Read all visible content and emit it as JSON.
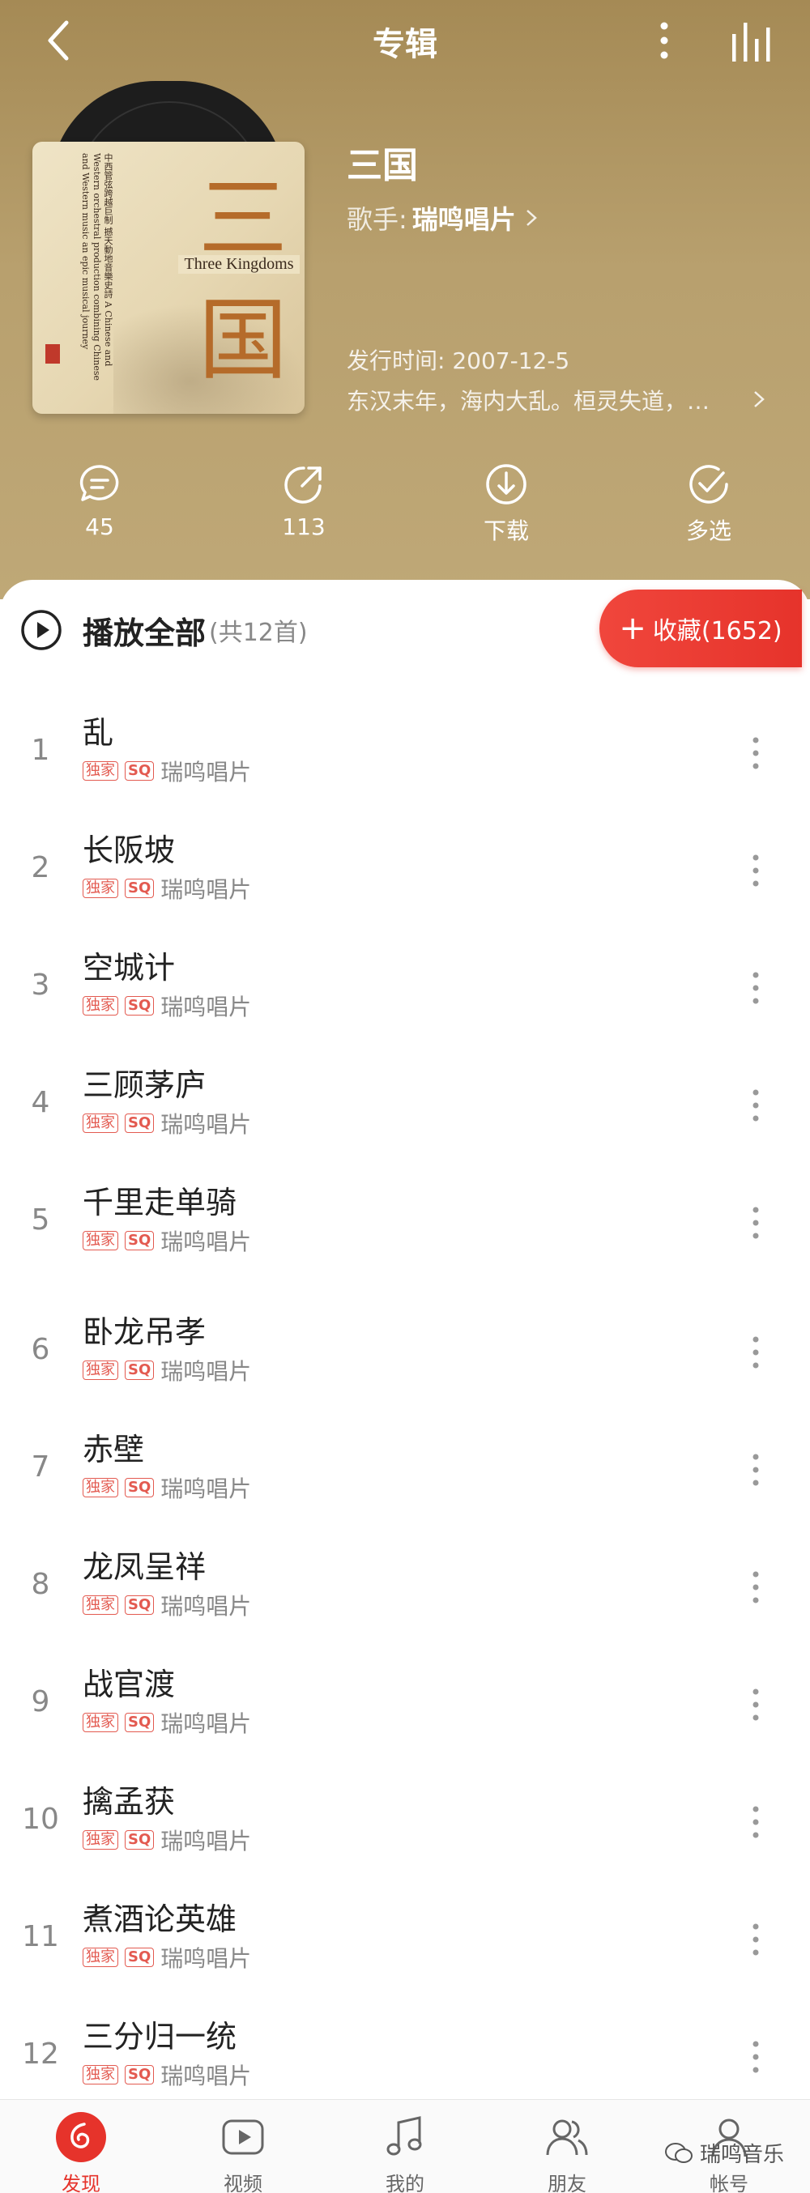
{
  "header": {
    "title": "专辑"
  },
  "album": {
    "name": "三国",
    "artist_prefix": "歌手:",
    "artist": "瑞鸣唱片",
    "release_date": "发行时间: 2007-12-5",
    "description": "东汉末年，海内大乱。桓灵失道，…",
    "cover": {
      "big_char": "三国",
      "english": "Three Kingdoms",
      "vertical_text": "中西管弦跨越巨制 撼天動地音樂史詩 A Chinese and Western orchestral production combining Chinese and Western music an epic musical journey"
    }
  },
  "actions": {
    "comments": "45",
    "share": "113",
    "download": "下载",
    "multiselect": "多选"
  },
  "playlist": {
    "play_all": "播放全部",
    "count": "(共12首)",
    "collect_label": "收藏(1652)"
  },
  "badges": {
    "exclusive": "独家",
    "sq": "SQ"
  },
  "tracks": [
    {
      "num": "1",
      "title": "乱",
      "artist": "瑞鸣唱片"
    },
    {
      "num": "2",
      "title": "长阪坡",
      "artist": "瑞鸣唱片"
    },
    {
      "num": "3",
      "title": "空城计",
      "artist": "瑞鸣唱片"
    },
    {
      "num": "4",
      "title": "三顾茅庐",
      "artist": "瑞鸣唱片"
    },
    {
      "num": "5",
      "title": "千里走单骑",
      "artist": "瑞鸣唱片"
    },
    {
      "num": "6",
      "title": "卧龙吊孝",
      "artist": "瑞鸣唱片"
    },
    {
      "num": "7",
      "title": "赤壁",
      "artist": "瑞鸣唱片"
    },
    {
      "num": "8",
      "title": "龙凤呈祥",
      "artist": "瑞鸣唱片"
    },
    {
      "num": "9",
      "title": "战官渡",
      "artist": "瑞鸣唱片"
    },
    {
      "num": "10",
      "title": "擒孟获",
      "artist": "瑞鸣唱片"
    },
    {
      "num": "11",
      "title": "煮酒论英雄",
      "artist": "瑞鸣唱片"
    },
    {
      "num": "12",
      "title": "三分归一统",
      "artist": "瑞鸣唱片"
    }
  ],
  "nav": {
    "discover": "发现",
    "video": "视频",
    "mine": "我的",
    "friends": "朋友",
    "account": "帐号"
  },
  "watermark": "瑞鸣音乐",
  "colors": {
    "accent": "#e6332b",
    "hero": "#b09664"
  }
}
